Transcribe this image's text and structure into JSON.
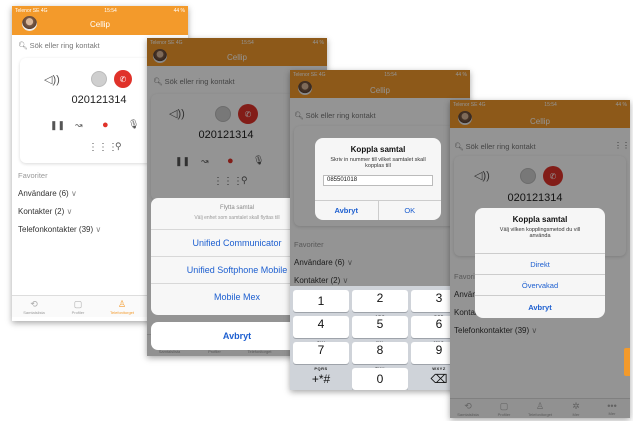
{
  "status": {
    "carrier": "Telenor SE",
    "network": "4G",
    "time": "15:54",
    "battery": "44 %"
  },
  "app": {
    "title": "Cellip",
    "search_placeholder": "Sök eller ring kontakt"
  },
  "call": {
    "number": "020121314"
  },
  "lists": {
    "header": "Favoriter",
    "users": "Användare (6)",
    "contacts": "Kontakter (2)",
    "phone_contacts": "Telefonkontakter (39)"
  },
  "tabs": [
    "Samtalslista",
    "Profiler",
    "Telefonitorget",
    "Mer"
  ],
  "tabs_s4": [
    "Samtalslista",
    "Profiler",
    "Telefonitorget",
    "Mer",
    "Mer"
  ],
  "transfer": {
    "title": "Flytta samtal",
    "subtitle": "Välj enhet som samtalet skall flyttas till",
    "options": [
      "Unified Communicator",
      "Unified Softphone Mobile",
      "Mobile Mex"
    ],
    "cancel": "Avbryt"
  },
  "connect": {
    "title": "Koppla samtal",
    "message": "Skriv in nummer till vilket samtalet skall kopplas till",
    "input_value": "085501018",
    "cancel": "Avbryt",
    "ok": "OK"
  },
  "method": {
    "title": "Koppla samtal",
    "message": "Välj vilken kopplingsmetod du vill använda",
    "options": [
      "Direkt",
      "Övervakad",
      "Avbryt"
    ]
  },
  "keypad": [
    {
      "d": "1",
      "l": ""
    },
    {
      "d": "2",
      "l": "ABC"
    },
    {
      "d": "3",
      "l": "DEF"
    },
    {
      "d": "4",
      "l": "GHI"
    },
    {
      "d": "5",
      "l": "JKL"
    },
    {
      "d": "6",
      "l": "MNO"
    },
    {
      "d": "7",
      "l": "PQRS"
    },
    {
      "d": "8",
      "l": "TUV"
    },
    {
      "d": "9",
      "l": "WXYZ"
    },
    {
      "d": "+*#",
      "l": ""
    },
    {
      "d": "0",
      "l": ""
    },
    {
      "d": "⌫",
      "l": ""
    }
  ],
  "colors": {
    "brand": "#f39a2b",
    "end_call": "#e0322a",
    "ios_blue": "#1d5fd0"
  }
}
